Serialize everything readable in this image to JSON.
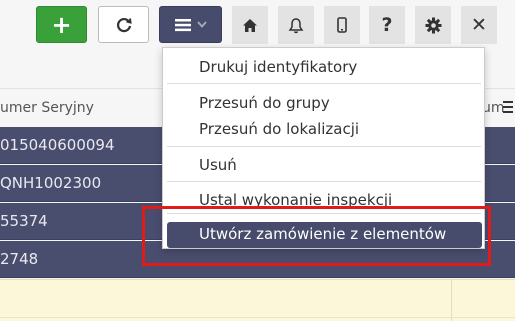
{
  "toolbar": {
    "add_label": "+",
    "buttons": [
      {
        "icon": "home-icon"
      },
      {
        "icon": "bell-icon"
      },
      {
        "icon": "mobile-icon"
      },
      {
        "icon": "help-icon",
        "label": "?"
      },
      {
        "icon": "gear-icon"
      },
      {
        "icon": "close-icon",
        "label": "✕"
      }
    ]
  },
  "table": {
    "column_header": "umer Seryjny",
    "column_header_right": "um",
    "rows": [
      "015040600094",
      "QNH1002300",
      "55374",
      "2748"
    ]
  },
  "dropdown": {
    "items": [
      "Drukuj identyfikatory",
      "Przesuń do grupy",
      "Przesuń do lokalizacji",
      "Usuń",
      "Ustal wykonanie inspekcji"
    ],
    "active_item": "Utwórz zamówienie z elementów"
  },
  "colors": {
    "accent": "#474c6c",
    "add": "#3aa13a",
    "highlight": "#e11a1a",
    "row": "#4a4e6e"
  }
}
